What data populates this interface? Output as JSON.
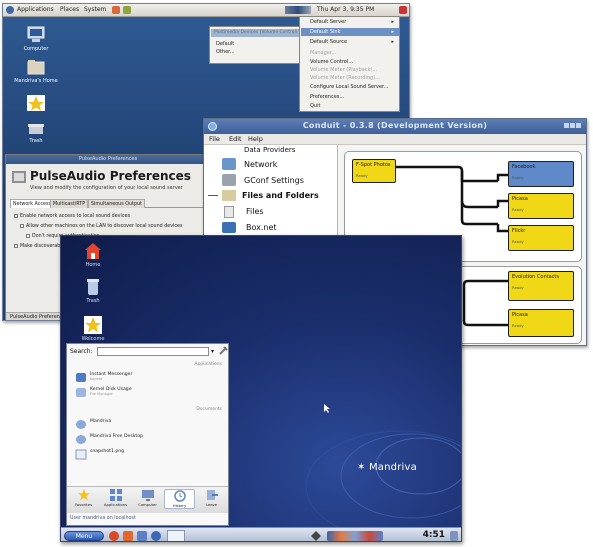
{
  "gnome": {
    "panel_menus": [
      "Applications",
      "Places",
      "System"
    ],
    "clock": "Thu Apr 3, 9:35 PM",
    "desktop_icons": [
      "Computer",
      "Mandriva's Home",
      "Trash"
    ],
    "ctx_left": {
      "header": "Multimedia Devices (Volume Control)",
      "items": [
        "Default",
        "Other..."
      ]
    },
    "ctx_right": {
      "items": [
        {
          "label": "Default Server",
          "arrow": "▸",
          "dim": false
        },
        {
          "label": "Default Sink",
          "arrow": "▸",
          "dim": false,
          "highlight": true
        },
        {
          "label": "Default Source",
          "arrow": "▸",
          "dim": false
        },
        {
          "label": "Manager...",
          "dim": true
        },
        {
          "label": "Volume Control...",
          "dim": false
        },
        {
          "label": "Volume Meter (Playback)...",
          "dim": true
        },
        {
          "label": "Volume Meter (Recording)...",
          "dim": true
        },
        {
          "label": "Configure Local Sound Server...",
          "dim": false
        },
        {
          "label": "Preferences...",
          "dim": false
        },
        {
          "label": "Quit",
          "dim": false
        }
      ]
    },
    "pulseaudio": {
      "window_title": "PulseAudio Preferences",
      "heading": "PulseAudio Preferences",
      "subtitle": "View and modify the configuration of your local sound server",
      "tabs": [
        "Network Access",
        "Multicast/RTP",
        "Simultaneous Output"
      ],
      "options": [
        "Enable network access to local sound devices",
        "Allow other machines on the LAN to discover local sound devices",
        "Don't require authentication",
        "Make discoverable..."
      ],
      "taskbar": "PulseAudio Preferences"
    }
  },
  "conduit": {
    "window_title": "Conduit - 0.3.8 (Development Version)",
    "menus": [
      "File",
      "Edit",
      "Help"
    ],
    "sidebar_header": "Data Providers",
    "sidebar_items": [
      {
        "label": "Network",
        "bold": false
      },
      {
        "label": "GConf Settings",
        "bold": false
      },
      {
        "label": "Files and Folders",
        "bold": true
      },
      {
        "label": "Files",
        "bold": false
      },
      {
        "label": "Box.net",
        "bold": false
      }
    ],
    "nodes": {
      "source1": "F-Spot Photos",
      "facebook": "Facebook",
      "picasa": "Picasa",
      "flickr": "Flickr",
      "evolution": "Evolution Contacts",
      "picasa2": "Picasa"
    },
    "node_status": "Ready"
  },
  "mandriva": {
    "desktop_icons": [
      "Home",
      "Trash",
      "Welcome"
    ],
    "search_label": "Search:",
    "headers": [
      "Applications",
      "Documents"
    ],
    "apps": [
      {
        "title": "Instant Messenger",
        "sub": "Kopete"
      },
      {
        "title": "Kernel Disk Usage",
        "sub": "File Manager"
      }
    ],
    "docs": [
      {
        "title": "Mandriva"
      },
      {
        "title": "Mandriva Free Desktop"
      },
      {
        "title": "snapshot1.png"
      }
    ],
    "tabs": [
      "Favorites",
      "Applications",
      "Computer",
      "History",
      "Leave"
    ],
    "user_line": "User mandriva on localhost",
    "logo": "Mandriva",
    "clock": "4:51",
    "panel_menu": "Menu"
  }
}
